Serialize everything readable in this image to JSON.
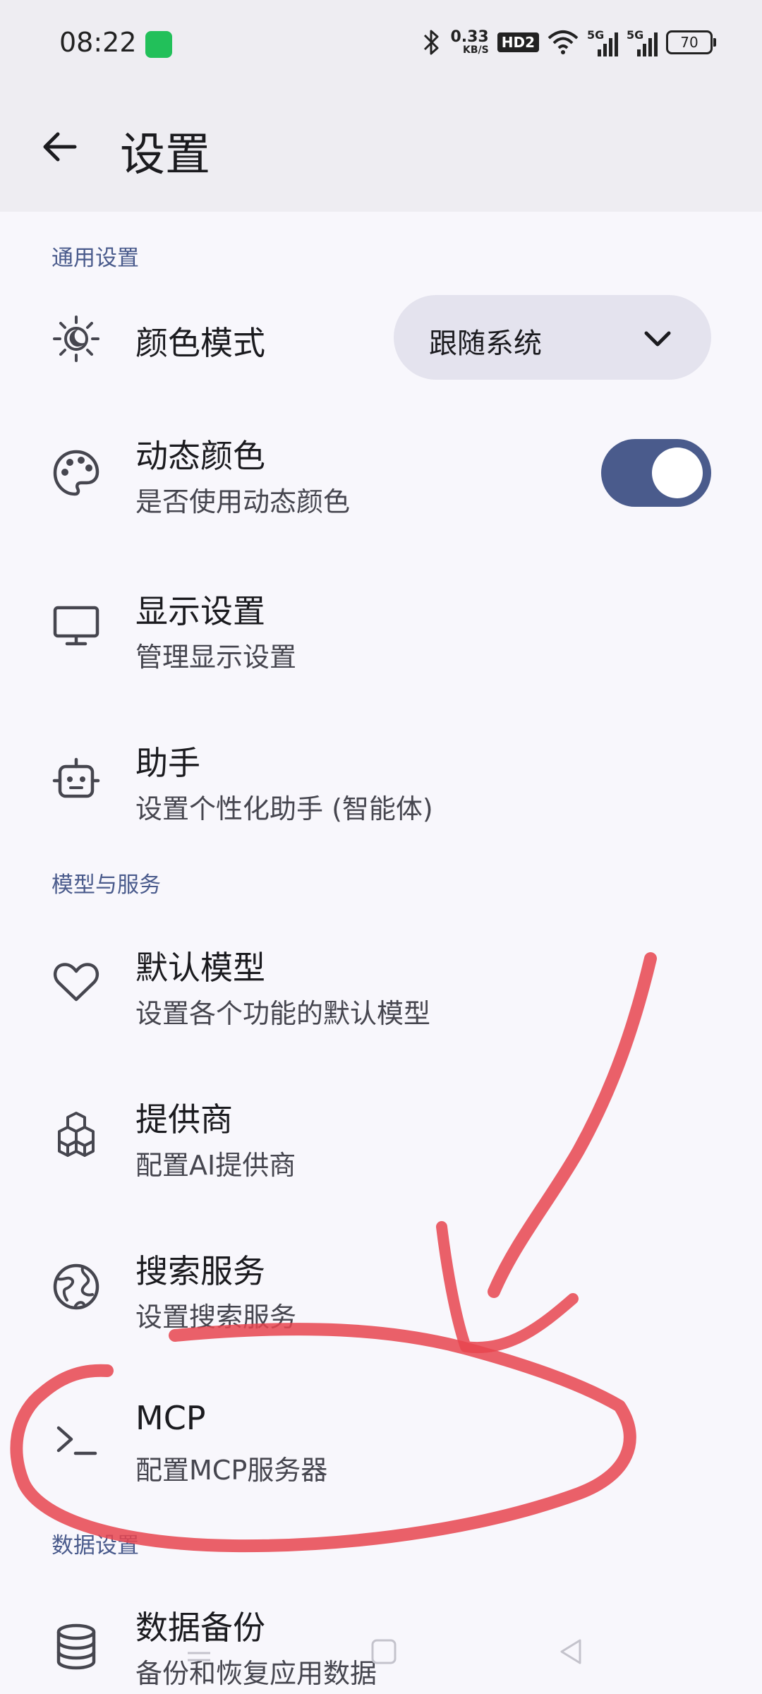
{
  "status_bar": {
    "time": "08:22",
    "net_speed_value": "0.33",
    "net_speed_unit": "KB/S",
    "hd_badge": "HD2",
    "signal1_label": "5G",
    "signal2_label": "5G",
    "battery": "70"
  },
  "app_bar": {
    "title": "设置"
  },
  "sections": {
    "general": "通用设置",
    "models": "模型与服务",
    "data": "数据设置"
  },
  "items": {
    "color_mode": {
      "title": "颜色模式",
      "value": "跟随系统",
      "icon": "brightness-auto-icon"
    },
    "dynamic_color": {
      "title": "动态颜色",
      "subtitle": "是否使用动态颜色",
      "enabled": true,
      "icon": "palette-icon"
    },
    "display": {
      "title": "显示设置",
      "subtitle": "管理显示设置",
      "icon": "monitor-icon"
    },
    "assistant": {
      "title": "助手",
      "subtitle": "设置个性化助手 (智能体)",
      "icon": "robot-icon"
    },
    "default_model": {
      "title": "默认模型",
      "subtitle": "设置各个功能的默认模型",
      "icon": "heart-icon"
    },
    "provider": {
      "title": "提供商",
      "subtitle": "配置AI提供商",
      "icon": "boxes-icon"
    },
    "search": {
      "title": "搜索服务",
      "subtitle": "设置搜索服务",
      "icon": "globe-icon"
    },
    "mcp": {
      "title": "MCP",
      "subtitle": "配置MCP服务器",
      "icon": "terminal-icon"
    },
    "backup": {
      "title": "数据备份",
      "subtitle": "备份和恢复应用数据",
      "icon": "database-icon"
    }
  },
  "colors": {
    "accent": "#4a5b8c",
    "annotation": "#e8454f",
    "background": "#f8f7fc",
    "app_bar": "#eeedf2"
  }
}
